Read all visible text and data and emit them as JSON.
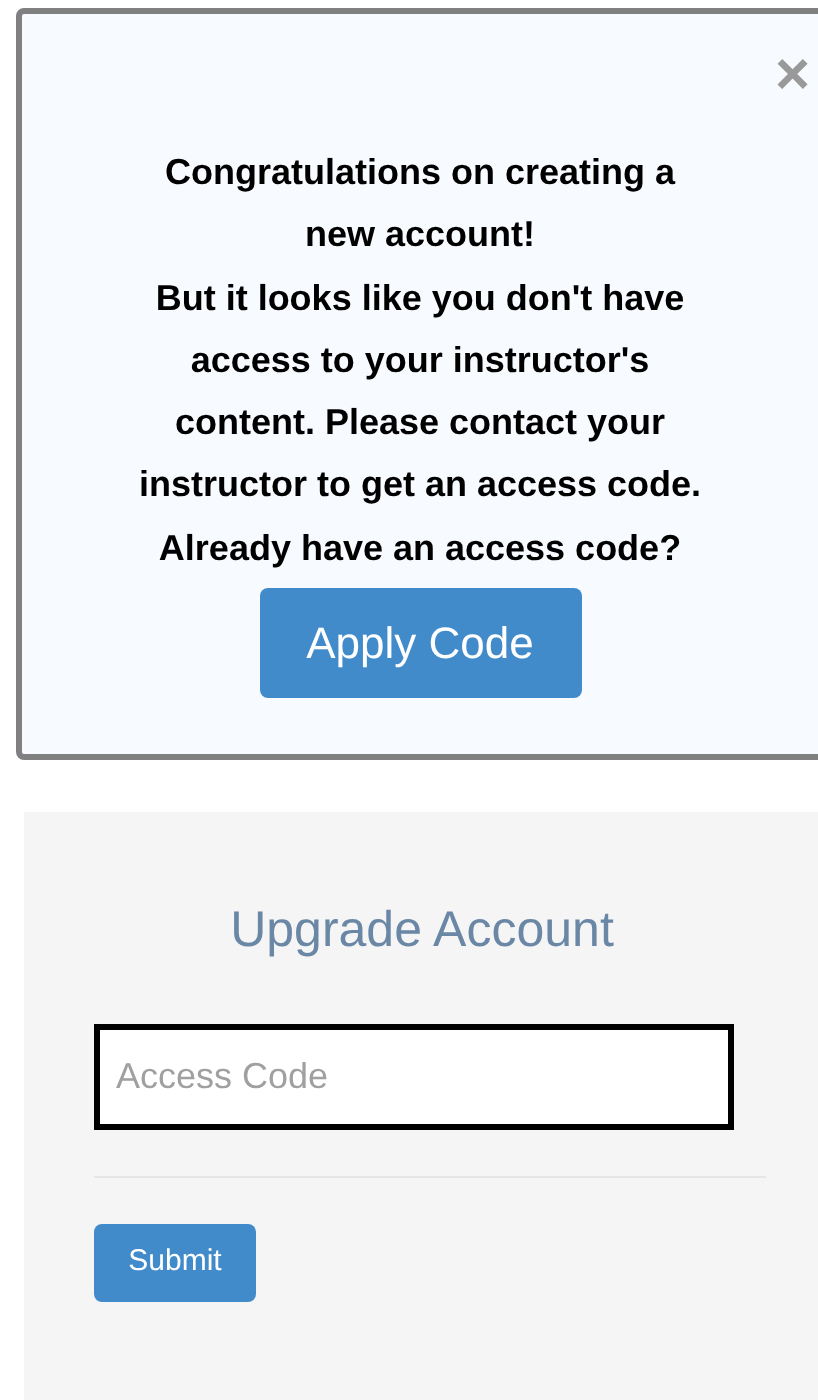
{
  "modal": {
    "close": "×",
    "message_lines": [
      "Congratulations on creating a",
      "new account!",
      "But it looks like you don't have",
      "access to your instructor's",
      "content. Please contact your",
      "instructor to get an access code.",
      "Already have an access code?"
    ],
    "button": "Apply Code"
  },
  "upgrade": {
    "title": "Upgrade Account",
    "field": {
      "placeholder": "Access Code",
      "focused": true
    },
    "button": "Submit"
  }
}
